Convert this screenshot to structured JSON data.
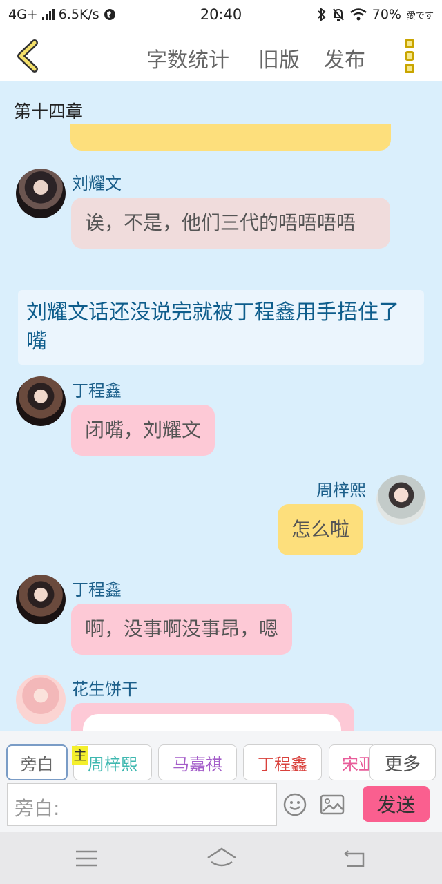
{
  "status_bar": {
    "network": "4G+",
    "speed": "6.5K/s",
    "time": "20:40",
    "battery": "70%",
    "carrier_icon_text": "愛です"
  },
  "toolbar": {
    "word_count": "字数统计",
    "old_version": "旧版",
    "publish": "发布"
  },
  "chat": {
    "chapter_title": "第十四章",
    "messages": [
      {
        "speaker": "刘耀文",
        "text": "诶，不是，他们三代的唔唔唔唔"
      },
      {
        "narration": "刘耀文话还没说完就被丁程鑫用手捂住了嘴"
      },
      {
        "speaker": "丁程鑫",
        "text": "闭嘴，刘耀文"
      },
      {
        "speaker": "周梓熙",
        "text": "怎么啦"
      },
      {
        "speaker": "丁程鑫",
        "text": "啊，没事啊没事昂，嗯"
      },
      {
        "speaker": "花生饼干",
        "text": ""
      }
    ]
  },
  "panel": {
    "chips": [
      {
        "label": "旁白",
        "color": "#666666"
      },
      {
        "label": "周梓熙",
        "color": "#3fb8b0"
      },
      {
        "label": "马嘉祺",
        "color": "#a45ec9"
      },
      {
        "label": "丁程鑫",
        "color": "#d9413c"
      },
      {
        "label": "宋亚",
        "color": "#e85c9a"
      }
    ],
    "more": "更多",
    "main_badge": "主",
    "input_placeholder": "旁白:",
    "send": "发送"
  },
  "colors": {
    "chat_bg": "#daeffc",
    "name_text": "#1c5f8a",
    "send_btn": "#fa5f8f",
    "yellow_bubble": "#fddf7c",
    "pink_bubble": "#fdc9d6"
  }
}
